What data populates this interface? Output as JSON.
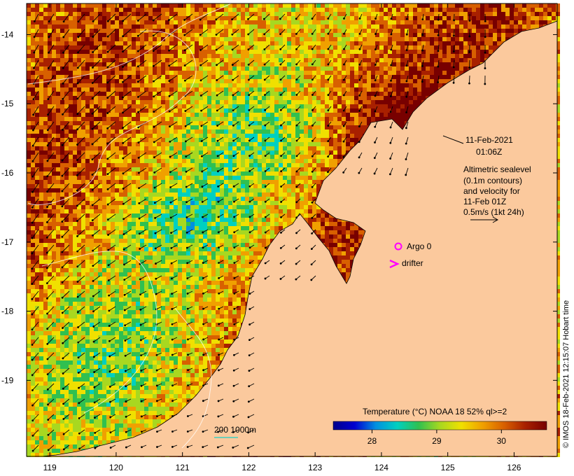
{
  "chart_data": {
    "type": "heatmap",
    "xlim": [
      118.65,
      126.65
    ],
    "ylim": [
      -20.1,
      -13.55
    ],
    "x_ticks": [
      "119",
      "120",
      "121",
      "122",
      "123",
      "124",
      "125",
      "126"
    ],
    "y_ticks": [
      "-14",
      "-15",
      "-16",
      "-17",
      "-18",
      "-19"
    ],
    "colorbar": {
      "title": "Temperature (°C) NOAA 18 52% ql>=2",
      "ticks": [
        "28",
        "29",
        "30"
      ],
      "range": [
        27.4,
        30.7
      ]
    },
    "annotations": {
      "date": "11-Feb-2021",
      "time": "01:06Z",
      "sealevel_lines": [
        "Altimetric sealevel",
        "(0.1m contours)",
        "and velocity for",
        "11-Feb 01Z",
        "0.5m/s (1kt 24h)"
      ],
      "argo_label": "Argo 0",
      "drifter_label": "drifter",
      "bathymetry_label": "200  1000m"
    },
    "credit": "© IMOS 18-Feb-2021 12:15:07 Hobart time"
  },
  "colors": {
    "land": "#fbc99d",
    "colormap": [
      "#00008b",
      "#0000d0",
      "#0090e0",
      "#00d0c0",
      "#30c050",
      "#a8d820",
      "#f0e000",
      "#f0a000",
      "#d86000",
      "#a82000",
      "#780000"
    ],
    "argo": "#ff00ff",
    "drifter": "#ff00ff",
    "contour": "#ffffff",
    "bathy_200": "#40d0c0"
  }
}
